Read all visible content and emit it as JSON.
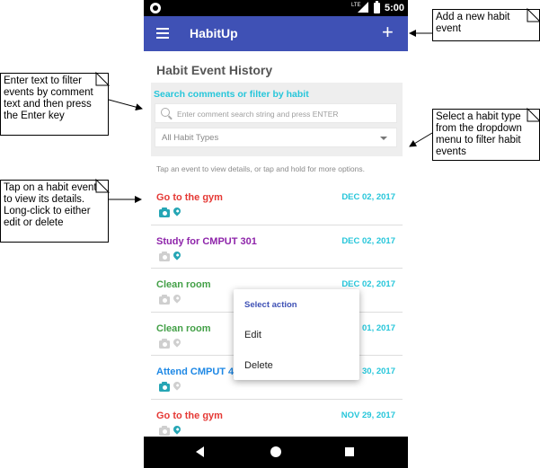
{
  "status_bar": {
    "network": "LTE",
    "time": "5:00"
  },
  "app_bar": {
    "title": "HabitUp"
  },
  "section_title": "Habit Event History",
  "filter": {
    "label": "Search comments or filter by habit",
    "search_placeholder": "Enter comment search string and press ENTER",
    "habit_type_selected": "All Habit Types"
  },
  "hint": "Tap an event to view details, or tap and hold for more options.",
  "events": [
    {
      "name": "Go to the gym",
      "date": "DEC 02, 2017",
      "color": "#e53935",
      "has_photo": true,
      "has_location": true
    },
    {
      "name": "Study for CMPUT 301",
      "date": "DEC 02, 2017",
      "color": "#8e24aa",
      "has_photo": false,
      "has_location": true
    },
    {
      "name": "Clean room",
      "date": "DEC 02, 2017",
      "color": "#43a047",
      "has_photo": false,
      "has_location": false
    },
    {
      "name": "Clean room",
      "date": "01, 2017",
      "color": "#43a047",
      "has_photo": false,
      "has_location": false
    },
    {
      "name": "Attend CMPUT 4",
      "date": "30, 2017",
      "color": "#1e88e5",
      "has_photo": true,
      "has_location": false
    },
    {
      "name": "Go to the gym",
      "date": "NOV 29, 2017",
      "color": "#e53935",
      "has_photo": false,
      "has_location": true
    }
  ],
  "context_menu": {
    "title": "Select action",
    "items": [
      "Edit",
      "Delete"
    ]
  },
  "callouts": {
    "add_event": "Add a new habit event",
    "search": "Enter text to filter events by comment text and then press the Enter key",
    "habit_type": "Select a habit type from the dropdown menu to filter habit events",
    "tap_event": "Tap on a habit event to view its details. Long-click to either edit or delete"
  },
  "colors": {
    "app_bar": "#3f51b5",
    "accent": "#26c6da",
    "active_icon": "#26a6b5",
    "inactive_icon": "#cfcfcf"
  }
}
